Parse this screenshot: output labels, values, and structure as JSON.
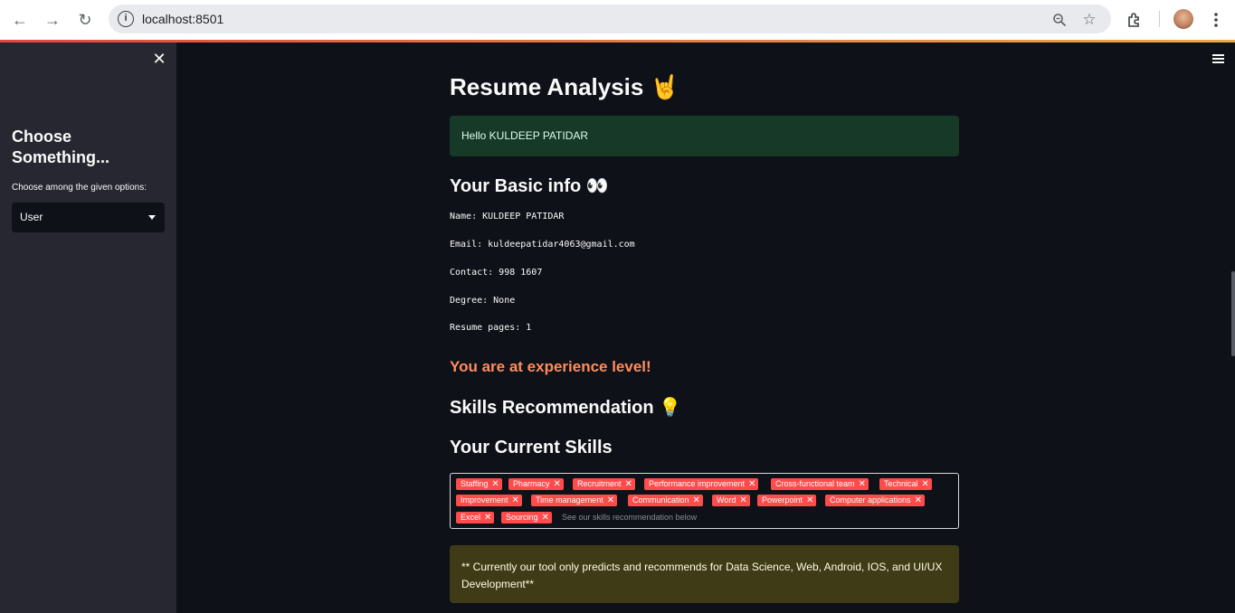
{
  "browser": {
    "url": "localhost:8501"
  },
  "sidebar": {
    "title": "Choose Something...",
    "select_label": "Choose among the given options:",
    "select_value": "User"
  },
  "main": {
    "title": "Resume Analysis 🤘",
    "greeting": "Hello KULDEEP PATIDAR",
    "basic_info_heading": "Your Basic info 👀",
    "info": {
      "name": "Name: KULDEEP PATIDAR",
      "email": "Email: kuldeepatidar4063@gmail.com",
      "contact": "Contact: 998 1607",
      "degree": "Degree: None",
      "pages": "Resume pages: 1"
    },
    "experience": "You are at experience level!",
    "skills_rec_heading": "Skills Recommendation 💡",
    "current_skills_heading": "Your Current Skills",
    "skills": [
      "Staffing",
      "Pharmacy",
      "Recruitment",
      "Performance improvement",
      "Cross-functional team",
      "Technical",
      "Improvement",
      "Time management",
      "Communication",
      "Word",
      "Powerpoint",
      "Computer applications",
      "Excel",
      "Sourcing"
    ],
    "skills_placeholder": "See our skills recommendation below",
    "notice": "** Currently our tool only predicts and recommends for Data Science, Web, Android, IOS, and UI/UX Development**"
  },
  "colors": {
    "accent": "#ff4b4b",
    "background": "#0e1117",
    "sidebar": "#262730",
    "success_bg": "#173928",
    "warning_bg": "#3e3b16",
    "experience_text": "#ff8c5e"
  }
}
